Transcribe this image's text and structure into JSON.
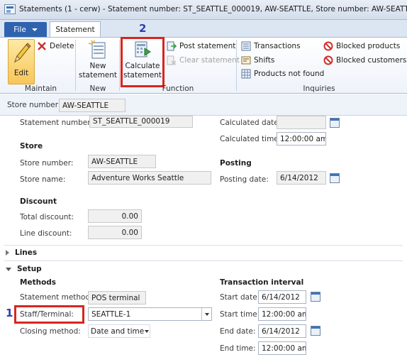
{
  "window": {
    "title": "Statements (1 - cerw) - Statement number: ST_SEATTLE_000019, AW-SEATTLE, Store number: AW-SEATTLE"
  },
  "tabs": {
    "file_label": "File",
    "statement_label": "Statement"
  },
  "ribbon": {
    "maintain": {
      "label": "Maintain",
      "edit": "Edit",
      "delete": "Delete"
    },
    "new": {
      "label": "New",
      "new_statement_line1": "New",
      "new_statement_line2": "statement"
    },
    "function": {
      "label": "Function",
      "calculate_line1": "Calculate",
      "calculate_line2": "statement",
      "post": "Post statement",
      "clear": "Clear statement"
    },
    "inquiries": {
      "label": "Inquiries",
      "transactions": "Transactions",
      "shifts": "Shifts",
      "products_not_found": "Products not found",
      "blocked_products": "Blocked products",
      "blocked_customers": "Blocked customers"
    }
  },
  "annotations": {
    "marker_1": "1",
    "marker_2": "2"
  },
  "store_bar": {
    "label": "Store number:",
    "value": "AW-SEATTLE"
  },
  "general": {
    "statement_number_label": "Statement number:",
    "statement_number_value": "ST_SEATTLE_000019",
    "calculated_date_label": "Calculated date:",
    "calculated_date_value": "",
    "calculated_time_label": "Calculated time:",
    "calculated_time_value": "12:00:00 am"
  },
  "store": {
    "header": "Store",
    "store_number_label": "Store number:",
    "store_number_value": "AW-SEATTLE",
    "store_name_label": "Store name:",
    "store_name_value": "Adventure Works Seattle"
  },
  "posting": {
    "header": "Posting",
    "posting_date_label": "Posting date:",
    "posting_date_value": "6/14/2012"
  },
  "discount": {
    "header": "Discount",
    "total_label": "Total discount:",
    "total_value": "0.00",
    "line_label": "Line discount:",
    "line_value": "0.00"
  },
  "sections": {
    "lines": "Lines",
    "setup": "Setup"
  },
  "methods": {
    "header": "Methods",
    "statement_method_label": "Statement method:",
    "statement_method_value": "POS terminal",
    "staff_terminal_label": "Staff/Terminal:",
    "staff_terminal_value": "SEATTLE-1",
    "closing_method_label": "Closing method:",
    "closing_method_value": "Date and time"
  },
  "transaction_interval": {
    "header": "Transaction interval",
    "start_date_label": "Start date:",
    "start_date_value": "6/14/2012",
    "start_time_label": "Start time:",
    "start_time_value": "12:00:00 am",
    "end_date_label": "End date:",
    "end_date_value": "6/14/2012",
    "end_time_label": "End time:",
    "end_time_value": "12:00:00 am"
  }
}
